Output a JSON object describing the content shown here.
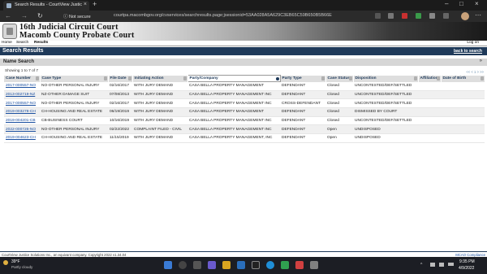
{
  "browser": {
    "tab_title": "Search Results - CourtView Justic",
    "tab_close": "×",
    "new_tab": "+",
    "back_glyph": "←",
    "forward_glyph": "→",
    "reload_glyph": "↻",
    "security_label": "ⓘ Not secure",
    "url": "courtpa.macombgov.org/cvservices/searchresults.page;jsessionid=53AA028A5A629C3EB65C59B650B5B66E",
    "menu_glyph": "⋯",
    "minimize_glyph": "–",
    "maximize_glyph": "□",
    "close_glyph": "×"
  },
  "site": {
    "court_line1": "16th Judicial Circuit Court",
    "court_line2": "Macomb County Probate Court"
  },
  "menu": {
    "home": "Home",
    "search": "Search",
    "results": "Results",
    "logon": "Log on"
  },
  "results_header": {
    "title": "Search Results",
    "back_link": "back to search"
  },
  "name_search": {
    "title": "Name Search",
    "chevron": "»"
  },
  "table": {
    "showing": "Showing 1 to 7 of 7",
    "pager": "<< < 1 > >>",
    "columns": [
      "Case Number",
      "Case Type",
      "File Date",
      "Initiating Action",
      "Party/Company",
      "Party Type",
      "Case Status",
      "Disposition",
      "Affiliation",
      "Date of Birth"
    ],
    "rows": [
      [
        "2017-000557-NO",
        "NO-OTHER PERSONAL INJURY",
        "02/16/2017",
        "WITH JURY DEMAND",
        "CASA BELLA PROPERTY MANAGEMENT",
        "DEFENDANT",
        "Closed",
        "UNCONTESTED/DEF/SETTLED",
        "",
        ""
      ],
      [
        "2013-002719-NZ",
        "NZ-OTHER DAMAGE SUIT",
        "07/08/2013",
        "WITH JURY DEMAND",
        "CASA BELLA PROPERTY MANAGEMENT INC",
        "DEFENDANT",
        "Closed",
        "UNCONTESTED/DEF/SETTLED",
        "",
        ""
      ],
      [
        "2017-000557-NO",
        "NO-OTHER PERSONAL INJURY",
        "02/16/2017",
        "WITH JURY DEMAND",
        "CASA BELLA PROPERTY MANAGEMENT INC",
        "CROSS-DEFENDANT",
        "Closed",
        "UNCONTESTED/DEF/SETTLED",
        "",
        ""
      ],
      [
        "2019-003278-CH",
        "CH-HOUSING AND REAL ESTATE",
        "06/19/2019",
        "WITH JURY DEMAND",
        "CASA BELLA PROPERTY MANAGEMENT",
        "DEFENDANT",
        "Closed",
        "DISMISSED BY COURT",
        "",
        ""
      ],
      [
        "2019-004201-CB",
        "CB-BUSINESS COURT",
        "10/16/2019",
        "WITH JURY DEMAND",
        "CASA BELLA PROPERTY MANAGEMENT INC",
        "DEFENDANT",
        "Closed",
        "UNCONTESTED/DEF/SETTLED",
        "",
        ""
      ],
      [
        "2022-000726-NO",
        "NO-OTHER PERSONAL INJURY",
        "02/22/2022",
        "COMPLAINT FILED - CIVIL",
        "CASA BELLA PROPERTY MANAGEMENT INC",
        "DEFENDANT",
        "Open",
        "UNDISPOSED",
        "",
        ""
      ],
      [
        "2019-004623-CH",
        "CH-HOUSING AND REAL ESTATE",
        "11/15/2019",
        "WITH JURY DEMAND",
        "CASA BELLA PROPERTY MANAGEMENT, INC",
        "DEFENDANT",
        "Open",
        "UNDISPOSED",
        "",
        ""
      ]
    ]
  },
  "footer": {
    "copyright": "CourtView Justice Solutions Inc., an equivant company. Copyright 2022 v1.34.04",
    "link": "MCAO Compliance"
  },
  "taskbar": {
    "temp": "39°F",
    "weather": "Partly cloudy",
    "tray_caret": "^",
    "time": "9:35 PM",
    "date": "4/9/2022"
  }
}
